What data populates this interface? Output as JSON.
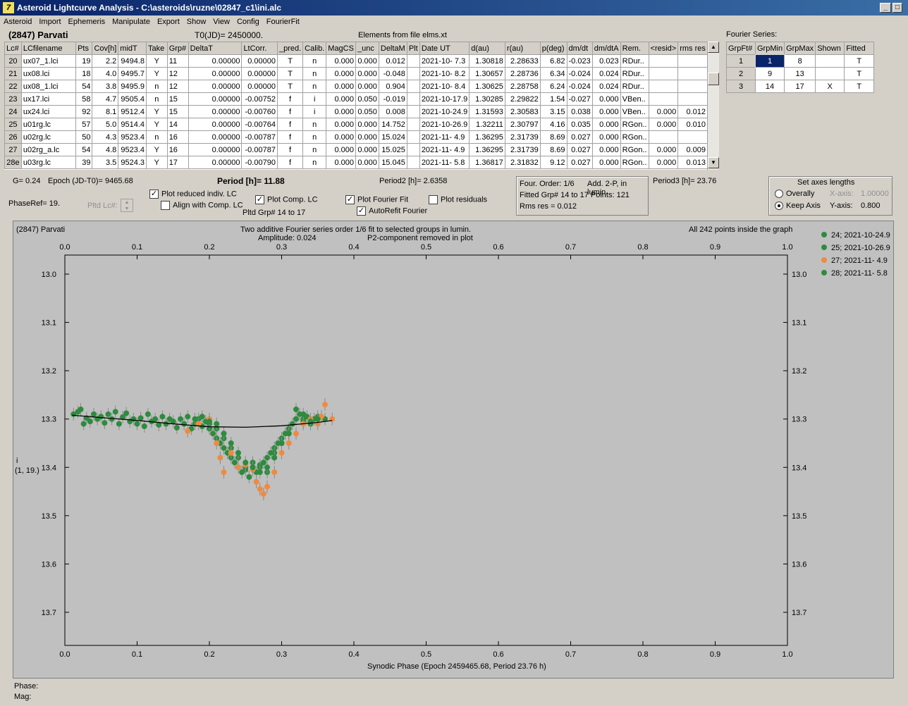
{
  "window": {
    "title": "Asteroid Lightcurve Analysis - C:\\asteroids\\ruzne\\02847_c1\\ini.alc",
    "icon_letter": "7"
  },
  "menu": [
    "Asteroid",
    "Import",
    "Ephemeris",
    "Manipulate",
    "Export",
    "Show",
    "View",
    "Config",
    "FourierFit"
  ],
  "header": {
    "asteroid": "(2847) Parvati",
    "t0": "T0(JD)= 2450000.",
    "elements": "Elements from file elms.xt",
    "fourier_label": "Fourier Series:"
  },
  "lc_table": {
    "columns": [
      "Lc#",
      "LCfilename",
      "Pts",
      "Cov[h]",
      "midT",
      "Take",
      "Grp#",
      "DeltaT",
      "LtCorr.",
      "_pred.",
      "Calib.",
      "MagCS",
      "_unc",
      "DeltaM",
      "Plt",
      "Date UT",
      "d(au)",
      "r(au)",
      "p(deg)",
      "dm/dt",
      "dm/dtA",
      "Rem.",
      "<resid>",
      "rms res"
    ],
    "rows": [
      [
        "20",
        "ux07_1.lci",
        "19",
        "2.2",
        "9494.8",
        "Y",
        "11",
        "0.00000",
        "0.00000",
        "T",
        "n",
        "0.000",
        "0.000",
        "0.012",
        "",
        "2021-10- 7.3",
        "1.30818",
        "2.28633",
        "6.82",
        "-0.023",
        "0.023",
        "RDur..",
        "",
        ""
      ],
      [
        "21",
        "ux08.lci",
        "18",
        "4.0",
        "9495.7",
        "Y",
        "12",
        "0.00000",
        "0.00000",
        "T",
        "n",
        "0.000",
        "0.000",
        "-0.048",
        "",
        "2021-10- 8.2",
        "1.30657",
        "2.28736",
        "6.34",
        "-0.024",
        "0.024",
        "RDur..",
        "",
        ""
      ],
      [
        "22",
        "ux08_1.lci",
        "54",
        "3.8",
        "9495.9",
        "n",
        "12",
        "0.00000",
        "0.00000",
        "T",
        "n",
        "0.000",
        "0.000",
        "0.904",
        "",
        "2021-10- 8.4",
        "1.30625",
        "2.28758",
        "6.24",
        "-0.024",
        "0.024",
        "RDur..",
        "",
        ""
      ],
      [
        "23",
        "ux17.lci",
        "58",
        "4.7",
        "9505.4",
        "n",
        "15",
        "0.00000",
        "-0.00752",
        "f",
        "i",
        "0.000",
        "0.050",
        "-0.019",
        "",
        "2021-10-17.9",
        "1.30285",
        "2.29822",
        "1.54",
        "-0.027",
        "0.000",
        "VBen..",
        "",
        ""
      ],
      [
        "24",
        "ux24.lci",
        "92",
        "8.1",
        "9512.4",
        "Y",
        "15",
        "0.00000",
        "-0.00760",
        "f",
        "i",
        "0.000",
        "0.050",
        "0.008",
        "",
        "2021-10-24.9",
        "1.31593",
        "2.30583",
        "3.15",
        "0.038",
        "0.000",
        "VBen..",
        "0.000",
        "0.012"
      ],
      [
        "25",
        "u01rg.lc",
        "57",
        "5.0",
        "9514.4",
        "Y",
        "14",
        "0.00000",
        "-0.00764",
        "f",
        "n",
        "0.000",
        "0.000",
        "14.752",
        "",
        "2021-10-26.9",
        "1.32211",
        "2.30797",
        "4.16",
        "0.035",
        "0.000",
        "RGon..",
        "0.000",
        "0.010"
      ],
      [
        "26",
        "u02rg.lc",
        "50",
        "4.3",
        "9523.4",
        "n",
        "16",
        "0.00000",
        "-0.00787",
        "f",
        "n",
        "0.000",
        "0.000",
        "15.024",
        "",
        "2021-11- 4.9",
        "1.36295",
        "2.31739",
        "8.69",
        "0.027",
        "0.000",
        "RGon..",
        "",
        ""
      ],
      [
        "27",
        "u02rg_a.lc",
        "54",
        "4.8",
        "9523.4",
        "Y",
        "16",
        "0.00000",
        "-0.00787",
        "f",
        "n",
        "0.000",
        "0.000",
        "15.025",
        "",
        "2021-11- 4.9",
        "1.36295",
        "2.31739",
        "8.69",
        "0.027",
        "0.000",
        "RGon..",
        "0.000",
        "0.009"
      ],
      [
        "28e",
        "u03rg.lc",
        "39",
        "3.5",
        "9524.3",
        "Y",
        "17",
        "0.00000",
        "-0.00790",
        "f",
        "n",
        "0.000",
        "0.000",
        "15.045",
        "",
        "2021-11- 5.8",
        "1.36817",
        "2.31832",
        "9.12",
        "0.027",
        "0.000",
        "RGon..",
        "0.000",
        "0.013"
      ]
    ]
  },
  "fourier_table": {
    "columns": [
      "GrpFt#",
      "GrpMin",
      "GrpMax",
      "Shown",
      "Fitted"
    ],
    "rows": [
      [
        "1",
        "1",
        "8",
        "",
        "T"
      ],
      [
        "2",
        "9",
        "13",
        "",
        "T"
      ],
      [
        "3",
        "14",
        "17",
        "X",
        "T"
      ]
    ]
  },
  "controls": {
    "g": "G= 0.24",
    "epoch": "Epoch (JD-T0)= 9465.68",
    "period": "Period [h]= 11.88",
    "period2": "Period2 [h]= 2.6358",
    "period3": "Period3 [h]= 23.76",
    "phase_ref": "PhaseRef= 19.",
    "pltd_lc": "Pltd Lc#:",
    "plot_reduced": "Plot reduced indiv. LC",
    "align_comp": "Align with Comp. LC",
    "plot_comp": "Plot Comp. LC",
    "pltd_grp": "Pltd Grp#  14 to   17",
    "plot_fourier": "Plot Fourier Fit",
    "autorefit": "AutoRefit Fourier",
    "plot_residuals": "Plot residuals",
    "four_order": "Four. Order:  1/6",
    "add2p": "Add. 2-P, in lumin.",
    "fitted": "Fitted Grp# 14 to 17 Points: 121",
    "rms": "Rms res     = 0.012",
    "axes_title": "Set axes lengths",
    "overally": "Overally",
    "keep_axis": "Keep Axis",
    "xaxis_label": "X-axis:",
    "xaxis_val": "1.00000",
    "yaxis_label": "Y-axis:",
    "yaxis_val": "0.800"
  },
  "plot": {
    "name": "(2847) Parvati",
    "title1": "Two additive Fourier series order 1/6 fit to selected groups in lumin.",
    "title2": "Amplitude: 0.024",
    "title3": "P2-component removed in plot",
    "note": "All 242 points inside the graph",
    "xlabel": "Synodic Phase (Epoch 2459465.68, Period 23.76 h)",
    "ylabel1": "i",
    "ylabel2": "(1, 19.)",
    "legend": [
      {
        "label": "24; 2021-10-24.9",
        "color": "#2e8b3e"
      },
      {
        "label": "25; 2021-10-26.9",
        "color": "#2e8b3e"
      },
      {
        "label": "27; 2021-11- 4.9",
        "color": "#f08a40"
      },
      {
        "label": "28; 2021-11- 5.8",
        "color": "#2e8b3e"
      }
    ]
  },
  "status": {
    "phase": "Phase:",
    "mag": "Mag:"
  },
  "chart_data": {
    "type": "scatter",
    "xlim": [
      0.0,
      1.0
    ],
    "ylim": [
      13.0,
      13.7
    ],
    "xticks": [
      "0.0",
      "0.1",
      "0.2",
      "0.3",
      "0.4",
      "0.5",
      "0.6",
      "0.7",
      "0.8",
      "0.9",
      "1.0"
    ],
    "yticks": [
      "13.0",
      "13.1",
      "13.2",
      "13.3",
      "13.4",
      "13.5",
      "13.6",
      "13.7"
    ],
    "fit_curve": [
      [
        0.01,
        13.292
      ],
      [
        0.05,
        13.297
      ],
      [
        0.1,
        13.303
      ],
      [
        0.15,
        13.31
      ],
      [
        0.2,
        13.316
      ],
      [
        0.25,
        13.317
      ],
      [
        0.3,
        13.314
      ],
      [
        0.35,
        13.307
      ],
      [
        0.37,
        13.303
      ]
    ],
    "series": [
      {
        "name": "24; 2021-10-24.9",
        "color": "#2e8b3e",
        "points": [
          [
            0.012,
            13.29
          ],
          [
            0.018,
            13.285
          ],
          [
            0.022,
            13.28
          ],
          [
            0.026,
            13.31
          ],
          [
            0.03,
            13.298
          ],
          [
            0.035,
            13.305
          ],
          [
            0.04,
            13.29
          ],
          [
            0.045,
            13.3
          ],
          [
            0.05,
            13.295
          ],
          [
            0.055,
            13.308
          ],
          [
            0.06,
            13.29
          ],
          [
            0.065,
            13.3
          ],
          [
            0.07,
            13.285
          ],
          [
            0.075,
            13.31
          ],
          [
            0.08,
            13.296
          ],
          [
            0.085,
            13.288
          ],
          [
            0.09,
            13.305
          ],
          [
            0.095,
            13.3
          ],
          [
            0.1,
            13.31
          ],
          [
            0.105,
            13.298
          ],
          [
            0.11,
            13.315
          ],
          [
            0.115,
            13.29
          ],
          [
            0.12,
            13.305
          ],
          [
            0.125,
            13.3
          ],
          [
            0.13,
            13.312
          ],
          [
            0.135,
            13.295
          ],
          [
            0.14,
            13.31
          ],
          [
            0.145,
            13.3
          ],
          [
            0.15,
            13.305
          ],
          [
            0.155,
            13.318
          ],
          [
            0.16,
            13.3
          ],
          [
            0.165,
            13.31
          ],
          [
            0.17,
            13.295
          ],
          [
            0.175,
            13.32
          ],
          [
            0.18,
            13.31
          ],
          [
            0.185,
            13.3
          ],
          [
            0.19,
            13.315
          ],
          [
            0.195,
            13.305
          ],
          [
            0.2,
            13.32
          ],
          [
            0.205,
            13.33
          ],
          [
            0.21,
            13.34
          ],
          [
            0.215,
            13.35
          ],
          [
            0.22,
            13.36
          ],
          [
            0.225,
            13.37
          ],
          [
            0.23,
            13.38
          ],
          [
            0.235,
            13.39
          ],
          [
            0.24,
            13.4
          ],
          [
            0.245,
            13.41
          ],
          [
            0.25,
            13.405
          ],
          [
            0.255,
            13.42
          ],
          [
            0.26,
            13.4
          ],
          [
            0.265,
            13.41
          ],
          [
            0.27,
            13.395
          ],
          [
            0.275,
            13.39
          ],
          [
            0.28,
            13.38
          ],
          [
            0.285,
            13.37
          ],
          [
            0.29,
            13.36
          ],
          [
            0.295,
            13.35
          ],
          [
            0.3,
            13.34
          ],
          [
            0.305,
            13.33
          ],
          [
            0.31,
            13.32
          ],
          [
            0.315,
            13.31
          ],
          [
            0.32,
            13.3
          ],
          [
            0.325,
            13.29
          ],
          [
            0.33,
            13.305
          ],
          [
            0.335,
            13.295
          ],
          [
            0.34,
            13.31
          ],
          [
            0.345,
            13.3
          ]
        ]
      },
      {
        "name": "25; 2021-10-26.9",
        "color": "#2e8b3e",
        "points": [
          [
            0.18,
            13.3
          ],
          [
            0.19,
            13.295
          ],
          [
            0.2,
            13.31
          ],
          [
            0.21,
            13.32
          ],
          [
            0.22,
            13.34
          ],
          [
            0.23,
            13.36
          ],
          [
            0.24,
            13.38
          ],
          [
            0.25,
            13.4
          ],
          [
            0.26,
            13.39
          ],
          [
            0.27,
            13.4
          ],
          [
            0.28,
            13.41
          ],
          [
            0.29,
            13.37
          ],
          [
            0.3,
            13.35
          ],
          [
            0.31,
            13.33
          ],
          [
            0.32,
            13.28
          ],
          [
            0.33,
            13.3
          ],
          [
            0.34,
            13.31
          ],
          [
            0.35,
            13.295
          ],
          [
            0.36,
            13.3
          ]
        ]
      },
      {
        "name": "27; 2021-11- 4.9",
        "color": "#f08a40",
        "points": [
          [
            0.17,
            13.325
          ],
          [
            0.185,
            13.31
          ],
          [
            0.2,
            13.3
          ],
          [
            0.21,
            13.35
          ],
          [
            0.215,
            13.38
          ],
          [
            0.22,
            13.41
          ],
          [
            0.23,
            13.37
          ],
          [
            0.24,
            13.4
          ],
          [
            0.25,
            13.395
          ],
          [
            0.26,
            13.405
          ],
          [
            0.265,
            13.43
          ],
          [
            0.27,
            13.445
          ],
          [
            0.275,
            13.455
          ],
          [
            0.28,
            13.44
          ],
          [
            0.29,
            13.41
          ],
          [
            0.3,
            13.37
          ],
          [
            0.31,
            13.35
          ],
          [
            0.32,
            13.33
          ],
          [
            0.33,
            13.31
          ],
          [
            0.34,
            13.3
          ],
          [
            0.35,
            13.31
          ],
          [
            0.355,
            13.295
          ],
          [
            0.36,
            13.27
          ],
          [
            0.37,
            13.3
          ]
        ]
      },
      {
        "name": "28; 2021-11- 5.8",
        "color": "#2e8b3e",
        "points": [
          [
            0.2,
            13.305
          ],
          [
            0.21,
            13.31
          ],
          [
            0.22,
            13.33
          ],
          [
            0.23,
            13.35
          ],
          [
            0.24,
            13.37
          ],
          [
            0.25,
            13.39
          ],
          [
            0.26,
            13.4
          ],
          [
            0.27,
            13.41
          ],
          [
            0.28,
            13.4
          ],
          [
            0.29,
            13.38
          ],
          [
            0.3,
            13.35
          ],
          [
            0.31,
            13.33
          ],
          [
            0.32,
            13.3
          ],
          [
            0.33,
            13.29
          ],
          [
            0.34,
            13.305
          ],
          [
            0.35,
            13.3
          ]
        ]
      }
    ]
  }
}
